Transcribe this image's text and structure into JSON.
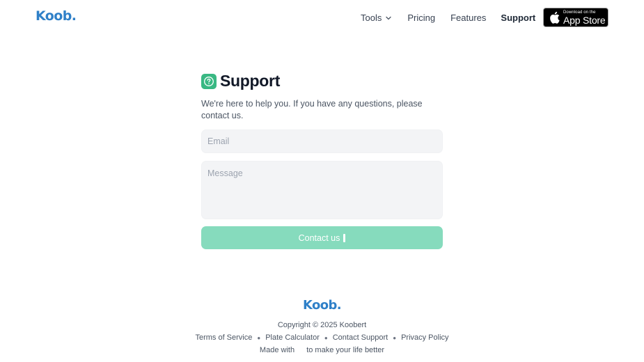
{
  "header": {
    "logo": "Koob.",
    "nav": {
      "tools": "Tools",
      "pricing": "Pricing",
      "features": "Features",
      "support": "Support"
    },
    "appstore": {
      "small": "Download on the",
      "big": "App Store"
    }
  },
  "main": {
    "title": "Support",
    "description": "We're here to help you. If you have any questions, please contact us.",
    "email_placeholder": "Email",
    "message_placeholder": "Message",
    "submit_label": "Contact us"
  },
  "footer": {
    "logo": "Koob.",
    "copyright": "Copyright © 2025 Koobert",
    "links": [
      "Terms of Service",
      "Plate Calculator",
      "Contact Support",
      "Privacy Policy"
    ],
    "made_with_prefix": "Made with",
    "made_with_suffix": "to make your life better"
  },
  "icons": {
    "tools_chevron": "chevron-down-icon",
    "title_icon": "question-circle-icon",
    "appstore_icon": "apple-icon",
    "submit_icon": "send-icon"
  },
  "colors": {
    "brand_blue": "#2f80c8",
    "accent_green": "#39b883",
    "button_green": "#86dbbd"
  }
}
